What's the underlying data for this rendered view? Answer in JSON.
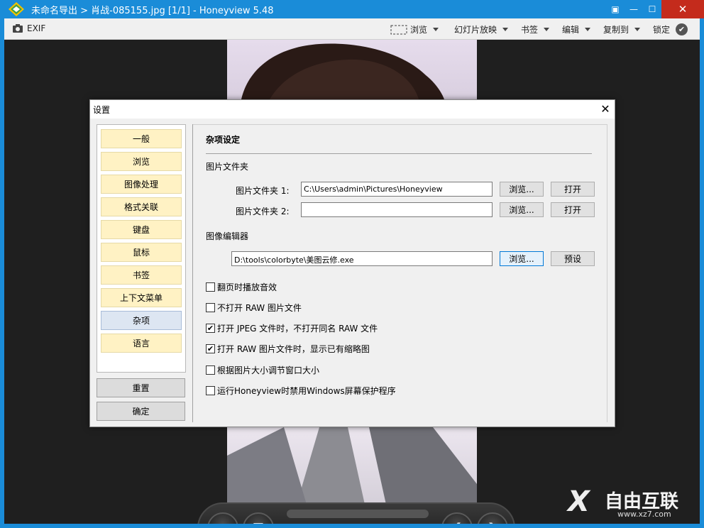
{
  "window": {
    "title": "未命名导出 > 肖战-085155.jpg [1/1] - Honeyview 5.48",
    "close_glyph": "✕",
    "maximize_glyph": "☐",
    "minimize_glyph": "—",
    "fullscreen_glyph": "▣"
  },
  "toolbar": {
    "exif": "EXIF",
    "browse": "浏览",
    "slideshow": "幻灯片放映",
    "bookmark": "书签",
    "edit": "编辑",
    "copy_to": "复制到",
    "lock": "锁定",
    "lock_check": "✔"
  },
  "dialog": {
    "title": "设置",
    "close_glyph": "✕",
    "nav": [
      "一般",
      "浏览",
      "图像处理",
      "格式关联",
      "键盘",
      "鼠标",
      "书签",
      "上下文菜单",
      "杂项",
      "语言"
    ],
    "selected_nav": "杂项",
    "reset": "重置",
    "ok": "确定",
    "section_title": "杂项设定",
    "picture_folder_group": "图片文件夹",
    "folder1_label": "图片文件夹 1:",
    "folder1_value": "C:\\Users\\admin\\Pictures\\Honeyview",
    "folder2_label": "图片文件夹 2:",
    "folder2_value": "",
    "browse_btn": "浏览...",
    "open_btn": "打开",
    "editor_group": "图像编辑器",
    "editor_value": "D:\\tools\\colorbyte\\美图云修.exe",
    "preset_btn": "预设",
    "options": [
      {
        "label": "翻页时播放音效",
        "checked": false
      },
      {
        "label": "不打开 RAW 图片文件",
        "checked": false
      },
      {
        "label": "打开 JPEG 文件时，不打开同名 RAW 文件",
        "checked": true
      },
      {
        "label": "打开 RAW 图片文件时，显示已有缩略图",
        "checked": true
      },
      {
        "label": "根据图片大小调节窗口大小",
        "checked": false
      },
      {
        "label": "运行Honeyview时禁用Windows屏幕保护程序",
        "checked": false
      }
    ],
    "check_glyph": "✔"
  },
  "controls": {
    "lock": "锁定",
    "lock_check": "✔",
    "eject_glyph": "⏏",
    "menu_glyph": "☰",
    "zoom_in": "+",
    "zoom_out": "−",
    "rotate_left": "↶",
    "rotate_right": "↷",
    "prev_glyph": "❮",
    "next_glyph": "❯"
  },
  "watermark": {
    "logo_mark": "X",
    "text": "自由互联",
    "url": "www.xz7.com"
  }
}
